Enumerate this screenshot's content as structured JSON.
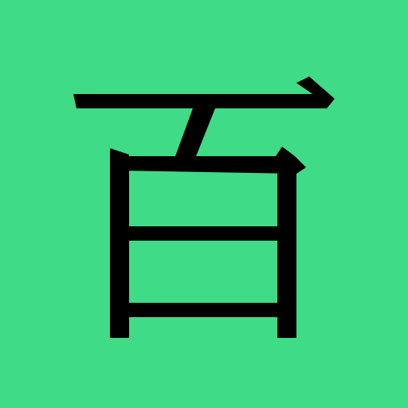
{
  "character": "百",
  "background_color": "#3fdb86",
  "glyph_color": "#000000"
}
